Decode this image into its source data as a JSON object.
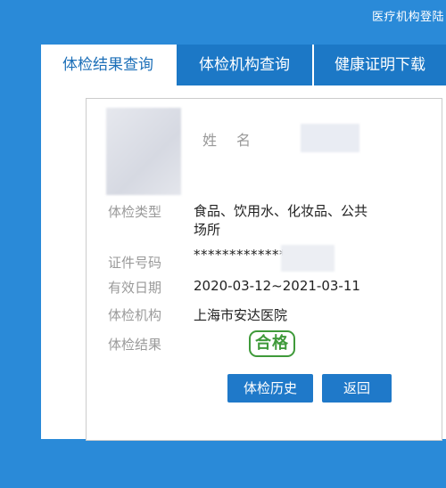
{
  "header": {
    "top_link": "医疗机构登陆"
  },
  "tabs": [
    {
      "label": "体检结果查询",
      "active": true
    },
    {
      "label": "体检机构查询",
      "active": false
    },
    {
      "label": "健康证明下载",
      "active": false
    }
  ],
  "result": {
    "name_label": "姓名",
    "type_label": "体检类型",
    "type_value": "食品、饮用水、化妆品、公共场所",
    "id_label": "证件号码",
    "id_value": "*************",
    "valid_label": "有效日期",
    "valid_value": "2020-03-12~2021-03-11",
    "org_label": "体检机构",
    "org_value": "上海市安达医院",
    "result_label": "体检结果",
    "result_value": "合格"
  },
  "buttons": {
    "history": "体检历史",
    "back": "返回"
  },
  "colors": {
    "background": "#2a8ad8",
    "tab_inactive": "#1c78c6",
    "button": "#1f79c9",
    "stamp": "#3f9a3a"
  }
}
